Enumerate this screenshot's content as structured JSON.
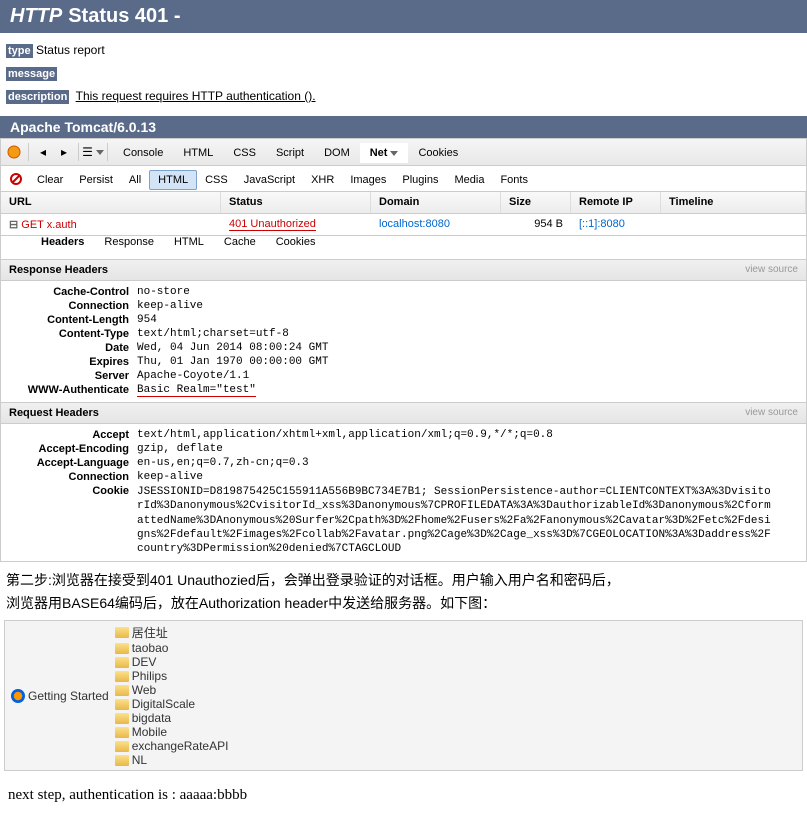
{
  "banner": {
    "prefix": "HTTP",
    "main": "Status 401 -"
  },
  "report": {
    "type_label": "type",
    "type_val": "Status report",
    "msg_label": "message",
    "desc_label": "description",
    "desc_val": "This request requires HTTP authentication ()."
  },
  "tomcat": "Apache Tomcat/6.0.13",
  "devtools": {
    "topTabs": [
      "Console",
      "HTML",
      "CSS",
      "Script",
      "DOM",
      "Net",
      "Cookies"
    ],
    "activeTop": "Net",
    "subBar": [
      "Clear",
      "Persist",
      "All",
      "HTML",
      "CSS",
      "JavaScript",
      "XHR",
      "Images",
      "Plugins",
      "Media",
      "Fonts"
    ],
    "activeSub": "HTML",
    "gridHeaders": {
      "url": "URL",
      "status": "Status",
      "domain": "Domain",
      "size": "Size",
      "remote": "Remote IP",
      "timeline": "Timeline"
    },
    "row": {
      "method": "GET x.auth",
      "status": "401 Unauthorized",
      "domain": "localhost:8080",
      "size": "954 B",
      "remote": "[::1]:8080"
    },
    "detailTabs": [
      "Headers",
      "Response",
      "HTML",
      "Cache",
      "Cookies"
    ],
    "activeDetail": "Headers",
    "respHeadersTitle": "Response Headers",
    "reqHeadersTitle": "Request Headers",
    "viewSource": "view source",
    "respHeaders": [
      {
        "k": "Cache-Control",
        "v": "no-store"
      },
      {
        "k": "Connection",
        "v": "keep-alive"
      },
      {
        "k": "Content-Length",
        "v": "954"
      },
      {
        "k": "Content-Type",
        "v": "text/html;charset=utf-8"
      },
      {
        "k": "Date",
        "v": "Wed, 04 Jun 2014 08:00:24 GMT"
      },
      {
        "k": "Expires",
        "v": "Thu, 01 Jan 1970 00:00:00 GMT"
      },
      {
        "k": "Server",
        "v": "Apache-Coyote/1.1"
      },
      {
        "k": "WWW-Authenticate",
        "v": "Basic Realm=\"test\"",
        "hl": true
      }
    ],
    "reqHeaders": [
      {
        "k": "Accept",
        "v": "text/html,application/xhtml+xml,application/xml;q=0.9,*/*;q=0.8"
      },
      {
        "k": "Accept-Encoding",
        "v": "gzip, deflate"
      },
      {
        "k": "Accept-Language",
        "v": "en-us,en;q=0.7,zh-cn;q=0.3"
      },
      {
        "k": "Connection",
        "v": "keep-alive"
      },
      {
        "k": "Cookie",
        "v": "JSESSIONID=D819875425C155911A556B9BC734E7B1; SessionPersistence-author=CLIENTCONTEXT%3A%3DvisitorId%3Danonymous%2CvisitorId_xss%3Danonymous%7CPROFILEDATA%3A%3DauthorizableId%3Danonymous%2CformattedName%3DAnonymous%20Surfer%2Cpath%3D%2Fhome%2Fusers%2Fa%2Fanonymous%2Cavatar%3D%2Fetc%2Fdesigns%2Fdefault%2Fimages%2Fcollab%2Favatar.png%2Cage%3D%2Cage_xss%3D%7CGEOLOCATION%3A%3Daddress%2Fcountry%3DPermission%20denied%7CTAGCLOUD"
      }
    ]
  },
  "chinese": {
    "line1": "第二步:浏览器在接受到401 Unauthozied后，会弹出登录验证的对话框。用户输入用户名和密码后，",
    "line2": "浏览器用BASE64编码后，放在Authorization header中发送给服务器。如下图："
  },
  "bookmarks": [
    "Getting Started",
    "居住址",
    "taobao",
    "DEV",
    "Philips",
    "Web",
    "DigitalScale",
    "bigdata",
    "Mobile",
    "exchangeRateAPI",
    "NL"
  ],
  "finalLine": "next step, authentication is : aaaaa:bbbb"
}
